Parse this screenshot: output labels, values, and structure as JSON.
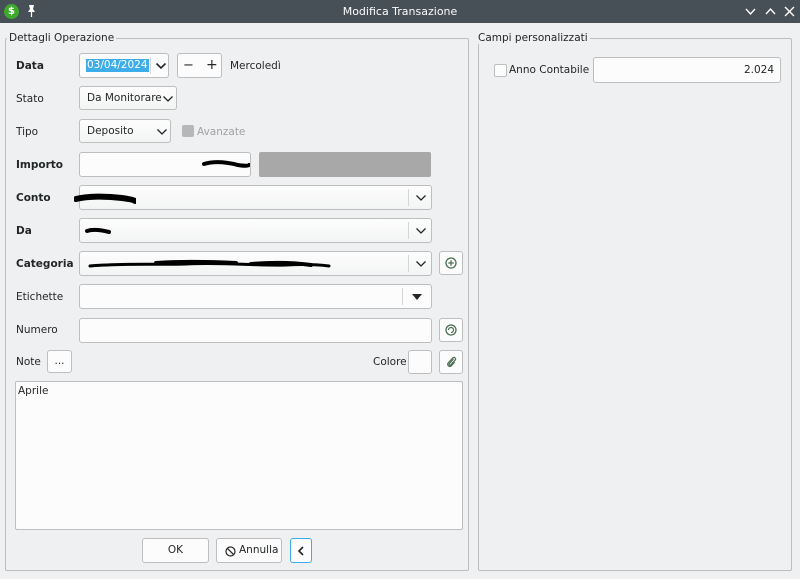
{
  "window": {
    "title": "Modifica Transazione"
  },
  "left_group": {
    "title": "Dettagli Operazione",
    "data": {
      "label": "Data",
      "value": "03/04/2024",
      "minus": "−",
      "plus": "+",
      "weekday": "Mercoledì"
    },
    "stato": {
      "label": "Stato",
      "value": "Da Monitorare"
    },
    "tipo": {
      "label": "Tipo",
      "value": "Deposito",
      "avanzate_label": "Avanzate"
    },
    "importo": {
      "label": "Importo"
    },
    "conto": {
      "label": "Conto"
    },
    "da": {
      "label": "Da"
    },
    "categoria": {
      "label": "Categoria"
    },
    "etichette": {
      "label": "Etichette",
      "value": ""
    },
    "numero": {
      "label": "Numero",
      "value": ""
    },
    "note": {
      "label": "Note",
      "dots_button": "...",
      "colore_label": "Colore",
      "text": "Aprile"
    },
    "buttons": {
      "ok": "OK",
      "annulla": "Annulla"
    }
  },
  "right_group": {
    "title": "Campi personalizzati",
    "anno_contabile": {
      "label": "Anno Contabile",
      "checked": false,
      "value": "2.024"
    }
  },
  "colors": {
    "title_bar": "#475057",
    "selection": "#3daee9",
    "disabled_box": "#a8a8a8",
    "window_bg": "#eff0f1"
  },
  "icons": [
    "money-app-icon",
    "pin-icon",
    "minimize-icon",
    "maximize-icon",
    "close-icon",
    "chevron-down-icon",
    "plus-circle-icon",
    "refresh-circle-icon",
    "paperclip-icon",
    "cancel-icon",
    "chevron-left-icon"
  ]
}
